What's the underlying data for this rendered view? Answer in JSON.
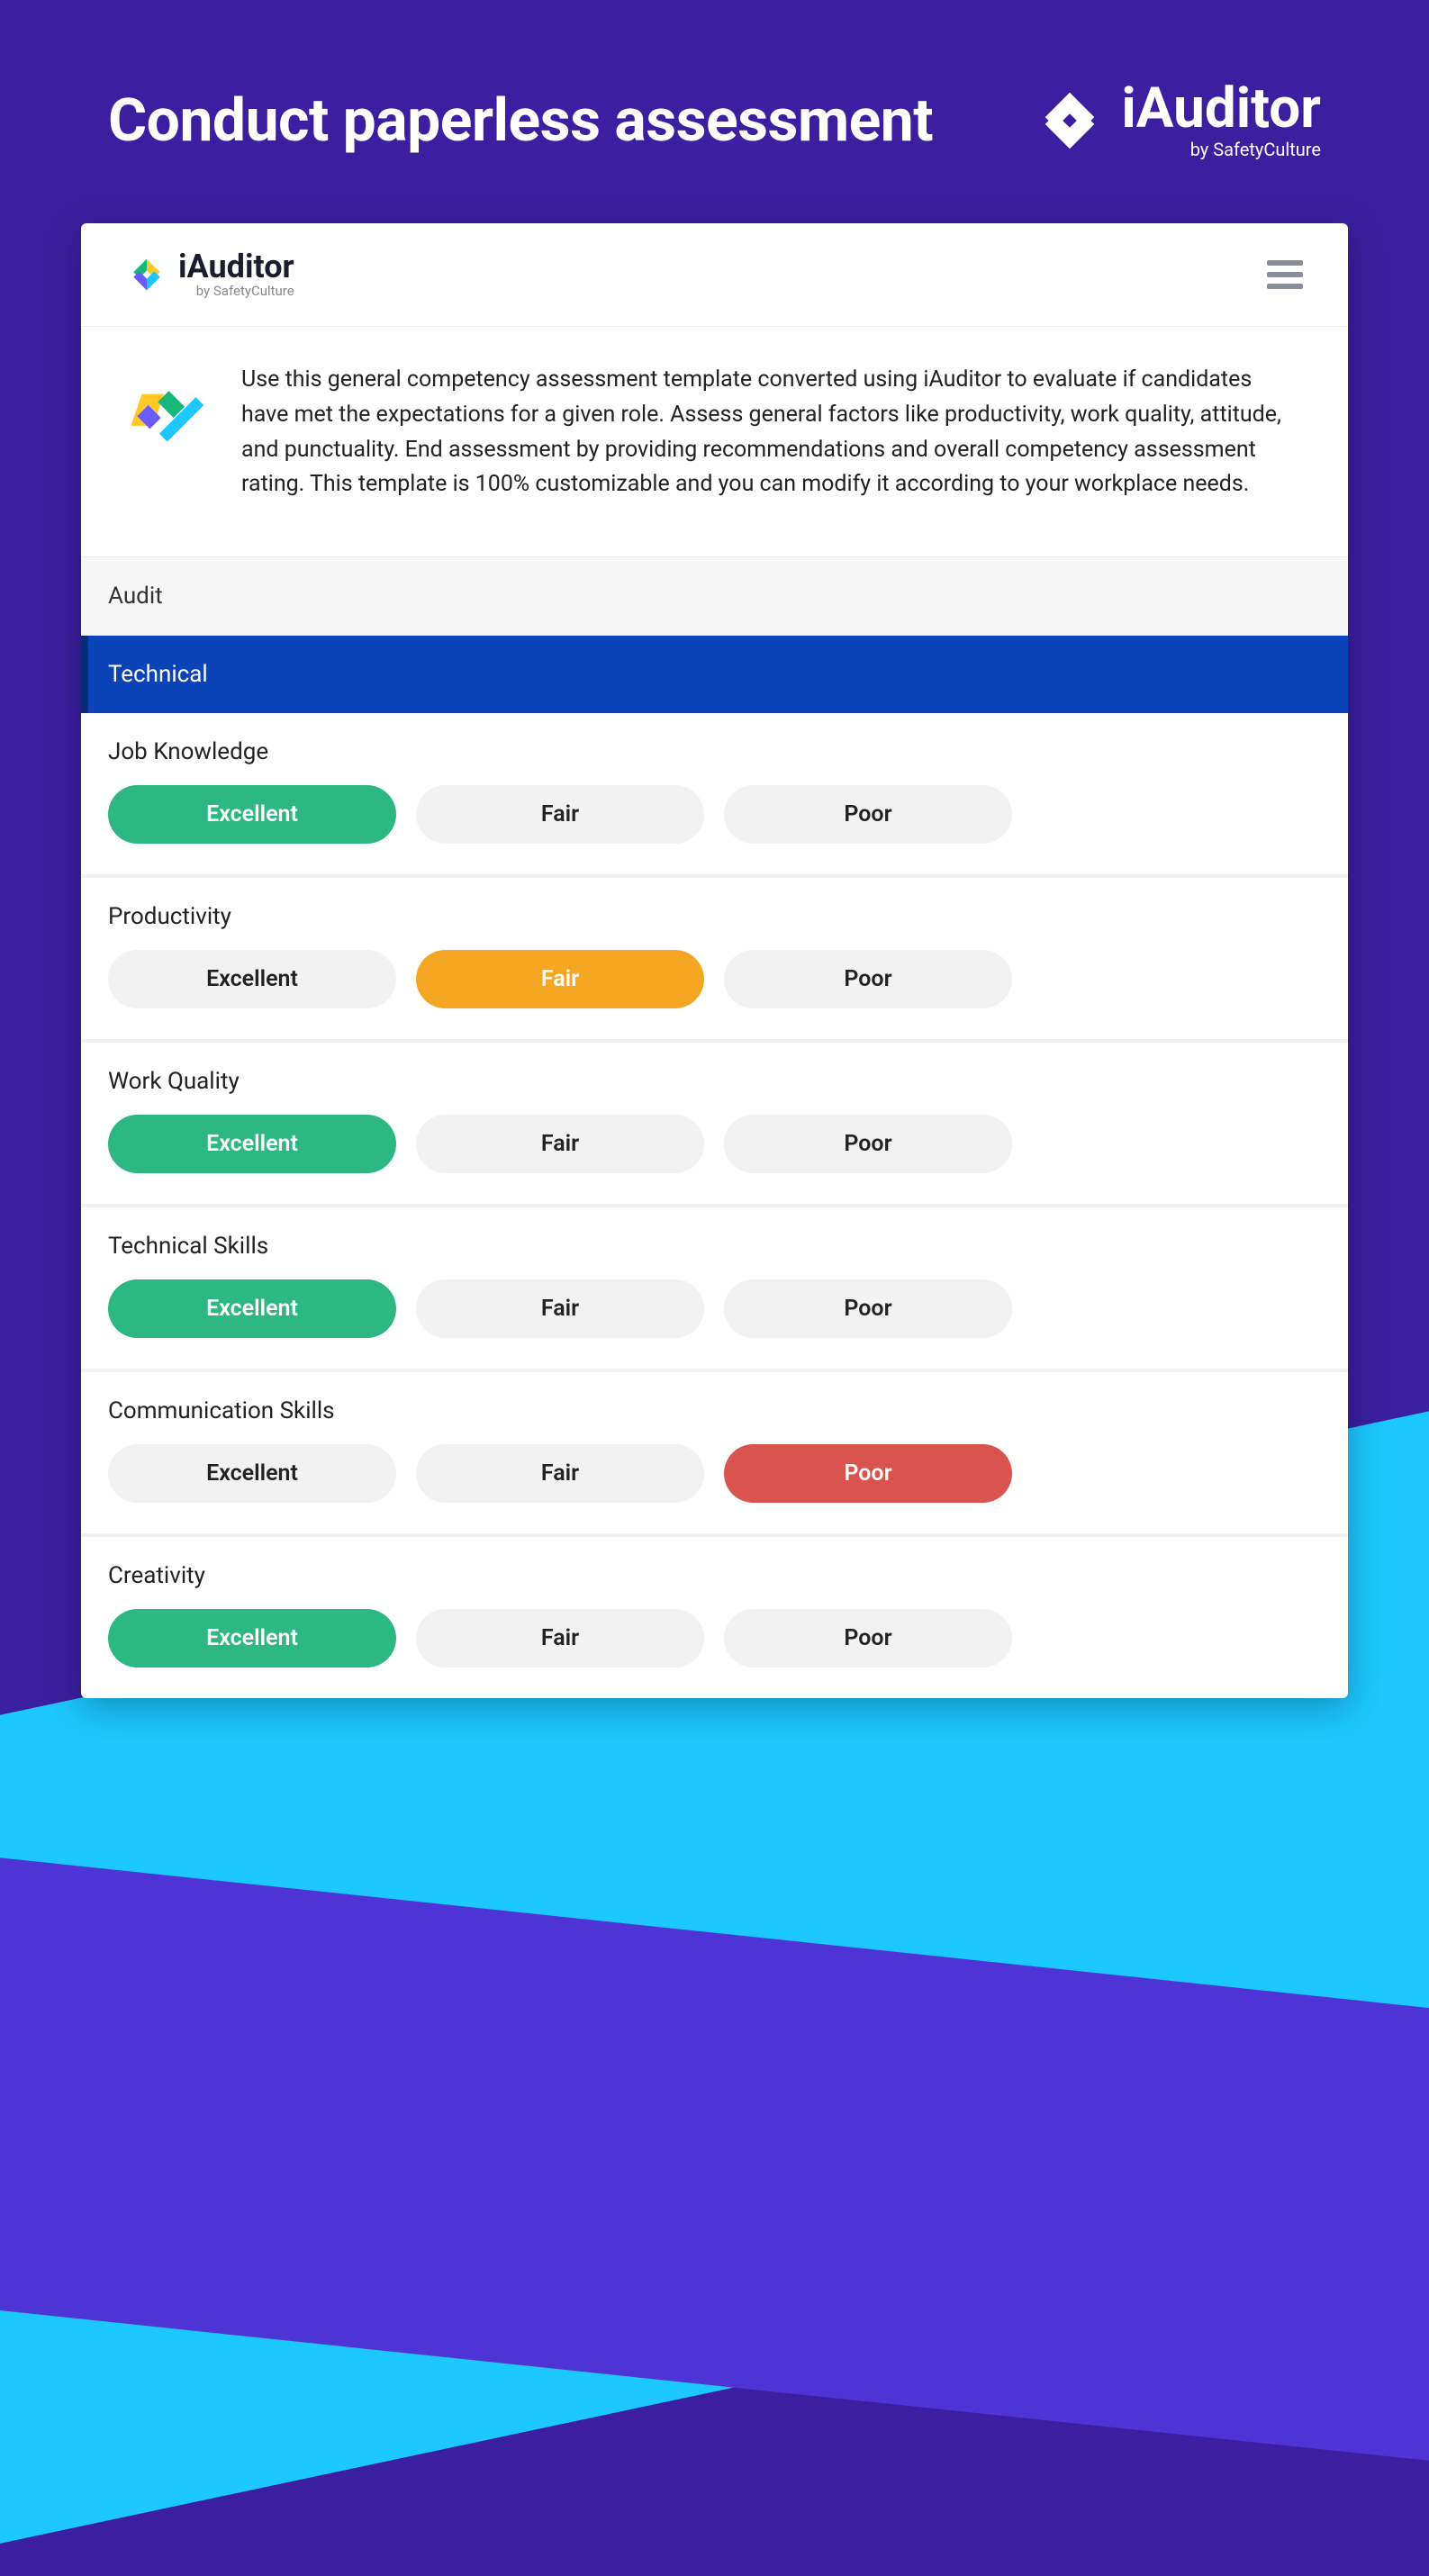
{
  "hero": {
    "title": "Conduct paperless assessment",
    "brand": "iAuditor",
    "brand_sub": "by SafetyCulture"
  },
  "app": {
    "brand": "iAuditor",
    "brand_sub": "by SafetyCulture",
    "intro": "Use this general competency assessment template converted using iAuditor to evaluate if candidates have met the expectations for a given role. Assess general factors like productivity, work quality, attitude, and punctuality. End assessment by providing recommendations and overall competency assessment rating. This template is 100% customizable and you can modify it according to your workplace needs."
  },
  "labels": {
    "audit": "Audit",
    "section1": "Technical",
    "excellent": "Excellent",
    "fair": "Fair",
    "poor": "Poor"
  },
  "questions": [
    {
      "label": "Job Knowledge",
      "selected": "excellent"
    },
    {
      "label": "Productivity",
      "selected": "fair"
    },
    {
      "label": "Work Quality",
      "selected": "excellent"
    },
    {
      "label": "Technical Skills",
      "selected": "excellent"
    },
    {
      "label": "Communication Skills",
      "selected": "poor"
    },
    {
      "label": "Creativity",
      "selected": "excellent"
    }
  ],
  "colors": {
    "excellent": "#2db783",
    "fair": "#f5a623",
    "poor": "#d9534f"
  }
}
